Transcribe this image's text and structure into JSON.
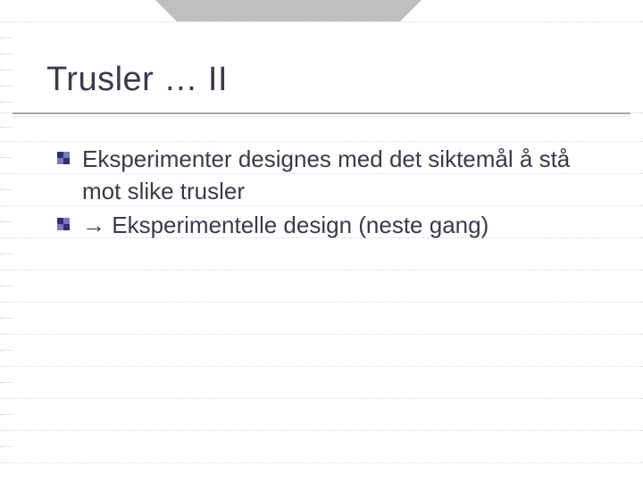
{
  "title": "Trusler … II",
  "bullets": [
    {
      "text": "Eksperimenter designes med det siktemål å stå mot slike trusler"
    },
    {
      "text": " Eksperimentelle design (neste gang)",
      "prefix_arrow": "→"
    }
  ]
}
